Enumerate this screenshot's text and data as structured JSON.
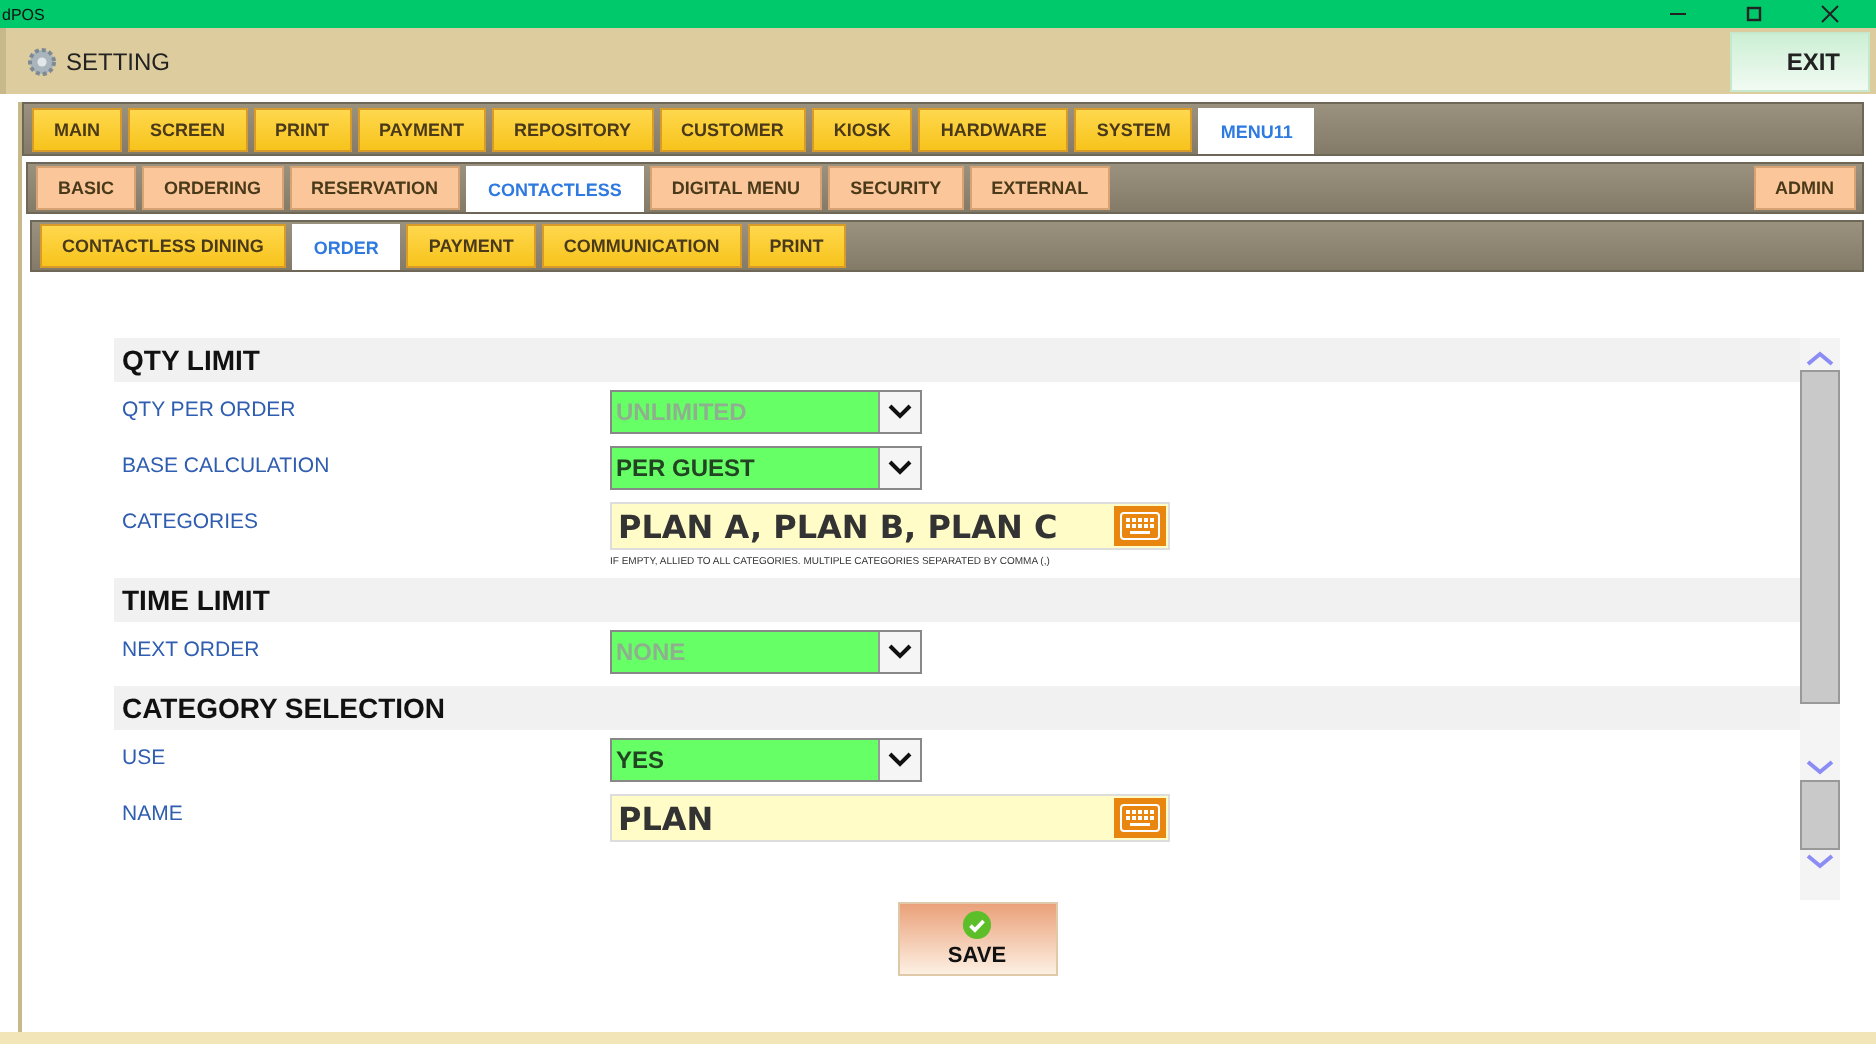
{
  "title_bar": {
    "title": "dPOS"
  },
  "header": {
    "title": "SETTING",
    "exit_button": "EXIT"
  },
  "tabs": [
    {
      "label": "MAIN",
      "selected": false
    },
    {
      "label": "SCREEN",
      "selected": false
    },
    {
      "label": "PRINT",
      "selected": false
    },
    {
      "label": "PAYMENT",
      "selected": false
    },
    {
      "label": "REPOSITORY",
      "selected": false
    },
    {
      "label": "CUSTOMER",
      "selected": false
    },
    {
      "label": "KIOSK",
      "selected": false
    },
    {
      "label": "HARDWARE",
      "selected": false
    },
    {
      "label": "SYSTEM",
      "selected": false
    },
    {
      "label": "MENU11",
      "selected": true
    }
  ],
  "sub_tabs": [
    {
      "label": "BASIC",
      "selected": false
    },
    {
      "label": "ORDERING",
      "selected": false
    },
    {
      "label": "RESERVATION",
      "selected": false
    },
    {
      "label": "CONTACTLESS",
      "selected": true
    },
    {
      "label": "DIGITAL MENU",
      "selected": false
    },
    {
      "label": "SECURITY",
      "selected": false
    },
    {
      "label": "EXTERNAL",
      "selected": false
    }
  ],
  "admin_tab": {
    "label": "ADMIN",
    "selected": false
  },
  "section_tabs": [
    {
      "label": "CONTACTLESS DINING",
      "selected": false
    },
    {
      "label": "ORDER",
      "selected": true
    },
    {
      "label": "PAYMENT",
      "selected": false
    },
    {
      "label": "COMMUNICATION",
      "selected": false
    },
    {
      "label": "PRINT",
      "selected": false
    }
  ],
  "sections": [
    {
      "title": "QTY LIMIT",
      "rows": [
        {
          "kind": "select",
          "label": "QTY PER ORDER",
          "value": "UNLIMITED",
          "disabled": true
        },
        {
          "kind": "select",
          "label": "BASE CALCULATION",
          "value": "PER GUEST",
          "disabled": false
        },
        {
          "kind": "text",
          "label": "CATEGORIES",
          "value": "PLAN A, PLAN B, PLAN C",
          "hint": "IF EMPTY, ALLIED TO ALL CATEGORIES. MULTIPLE CATEGORIES SEPARATED BY COMMA (,)"
        }
      ]
    },
    {
      "title": "TIME LIMIT",
      "rows": [
        {
          "kind": "select",
          "label": "NEXT ORDER",
          "value": "NONE",
          "disabled": true
        }
      ]
    },
    {
      "title": "CATEGORY SELECTION",
      "rows": [
        {
          "kind": "select",
          "label": "USE",
          "value": "YES",
          "disabled": false
        },
        {
          "kind": "text",
          "label": "NAME",
          "value": "PLAN"
        }
      ]
    }
  ],
  "save_button": "SAVE"
}
